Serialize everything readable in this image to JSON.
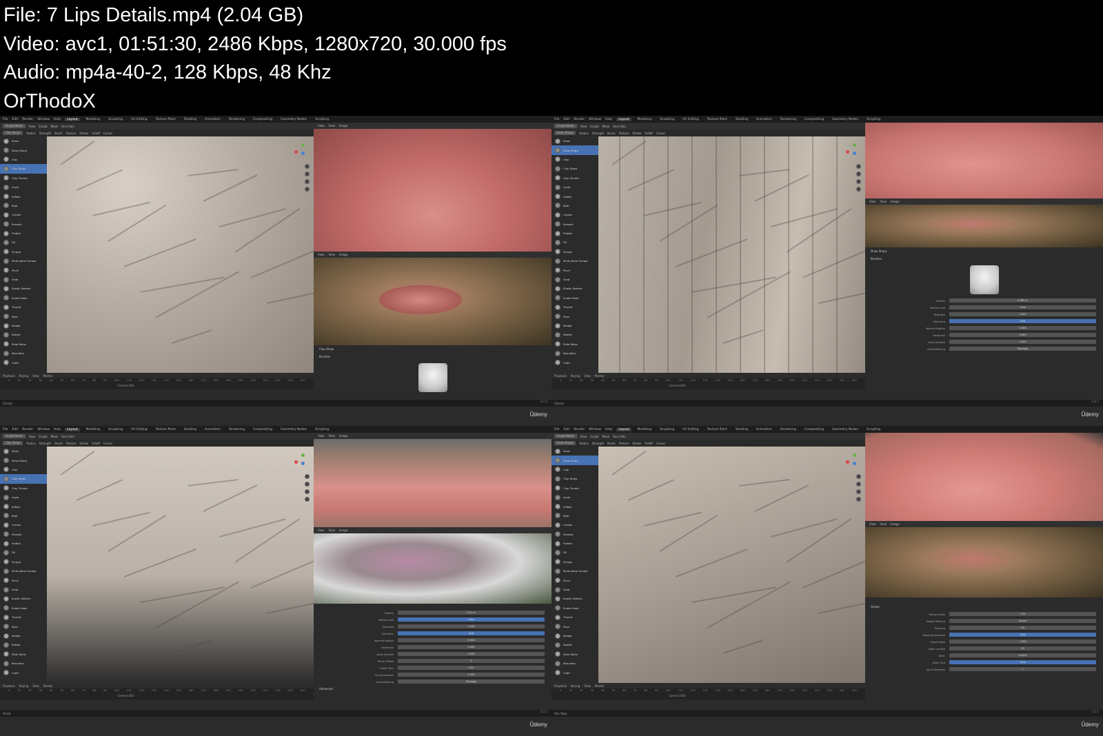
{
  "info": {
    "file": "File: 7  Lips Details.mp4 (2.04 GB)",
    "video": "Video: avc1, 01:51:30, 2486 Kbps, 1280x720, 30.000 fps",
    "audio": "Audio: mp4a-40-2, 128 Kbps, 48 Khz",
    "credit": "OrThodoX"
  },
  "blender": {
    "menu": [
      "File",
      "Edit",
      "Render",
      "Window",
      "Help"
    ],
    "workspaces": [
      "Layout",
      "Modeling",
      "Sculpting",
      "UV Editing",
      "Texture Paint",
      "Shading",
      "Animation",
      "Rendering",
      "Compositing",
      "Geometry Nodes",
      "Scripting"
    ],
    "active_workspace": "Layout",
    "mode": "Sculpt Mode",
    "header_items": [
      "View",
      "Sculpt",
      "Mask",
      "Face Sets"
    ],
    "tool_header": [
      "Radius",
      "Strength",
      "Brush",
      "Texture",
      "Stroke",
      "Falloff",
      "Cursor"
    ],
    "tools": [
      "Draw",
      "Draw Sharp",
      "Clay",
      "Clay Strips",
      "Clay Thumb",
      "Layer",
      "Inflate",
      "Blob",
      "Crease",
      "Smooth",
      "Flatten",
      "Fill",
      "Scrape",
      "Multi-plane Scrape",
      "Pinch",
      "Grab",
      "Elastic Deform",
      "Snake Hook",
      "Thumb",
      "Pose",
      "Nudge",
      "Rotate",
      "Slide Relax",
      "Boundary",
      "Cloth"
    ],
    "timeline": [
      "Playback",
      "Keying",
      "View",
      "Marker"
    ],
    "ruler": [
      "0",
      "10",
      "20",
      "30",
      "40",
      "50",
      "60",
      "70",
      "80",
      "90",
      "100",
      "110",
      "120",
      "130",
      "140",
      "150",
      "160",
      "170",
      "180",
      "190",
      "200",
      "210",
      "220",
      "230",
      "240",
      "250"
    ],
    "camera_label": "Camera.003",
    "image_header": [
      "View",
      "View",
      "Image"
    ],
    "udemy": "Ûdemy",
    "version": "3.2.1"
  },
  "thumbs": [
    {
      "brush": "Clay Strips",
      "active_tool": 3,
      "status": "Cancel",
      "props_title": "Clay Strips",
      "props_section": "Brushes",
      "props": []
    },
    {
      "brush": "Draw Sharp",
      "active_tool": 1,
      "status": "Cancel",
      "props_title": "Draw Sharp",
      "props_section": "Brushes",
      "props": [
        {
          "label": "Radius",
          "value": "0.083 m"
        },
        {
          "label": "Radius Unit",
          "value": "View"
        },
        {
          "label": "Strength",
          "value": "1.000"
        },
        {
          "label": "Direction",
          "value": "Add"
        },
        {
          "label": "Normal Radius",
          "value": "0.500"
        },
        {
          "label": "Hardness",
          "value": "0.000"
        },
        {
          "label": "Auto Smooth",
          "value": "0.000"
        },
        {
          "label": "Auto-Masking",
          "value": "Topology"
        }
      ]
    },
    {
      "brush": "Clay Strips",
      "active_tool": 3,
      "status": "Scroll",
      "props_title": "",
      "props_section": "Advanced",
      "props": [
        {
          "label": "Radius",
          "value": "0.11 m"
        },
        {
          "label": "Radius Unit",
          "value": "View"
        },
        {
          "label": "Strength",
          "value": "1.000"
        },
        {
          "label": "Direction",
          "value": "Add"
        },
        {
          "label": "Normal Radius",
          "value": "0.500"
        },
        {
          "label": "Hardness",
          "value": "1.000"
        },
        {
          "label": "Auto Smooth",
          "value": "0.000"
        },
        {
          "label": "Plane Offset",
          "value": "0"
        },
        {
          "label": "Plane Trim",
          "value": "0.50"
        },
        {
          "label": "Tip Roundness",
          "value": "1.000"
        },
        {
          "label": "Auto-Masking",
          "value": "Topology"
        }
      ]
    },
    {
      "brush": "Draw Sharp",
      "active_tool": 1,
      "status": "Ann Step",
      "props_title": "",
      "props_section": "Stroke",
      "props": [
        {
          "label": "Sample Bias",
          "value": "1.00"
        },
        {
          "label": "Stroke Method",
          "value": "Space"
        },
        {
          "label": "Spacing",
          "value": "3%"
        },
        {
          "label": "Spacing Distance",
          "value": "View"
        },
        {
          "label": "Dash Ratio",
          "value": "1.000"
        },
        {
          "label": "Dash Length",
          "value": "20"
        },
        {
          "label": "Jitter",
          "value": "0.0000"
        },
        {
          "label": "Jitter Unit",
          "value": "View"
        },
        {
          "label": "Input Samples",
          "value": "1"
        }
      ]
    }
  ]
}
